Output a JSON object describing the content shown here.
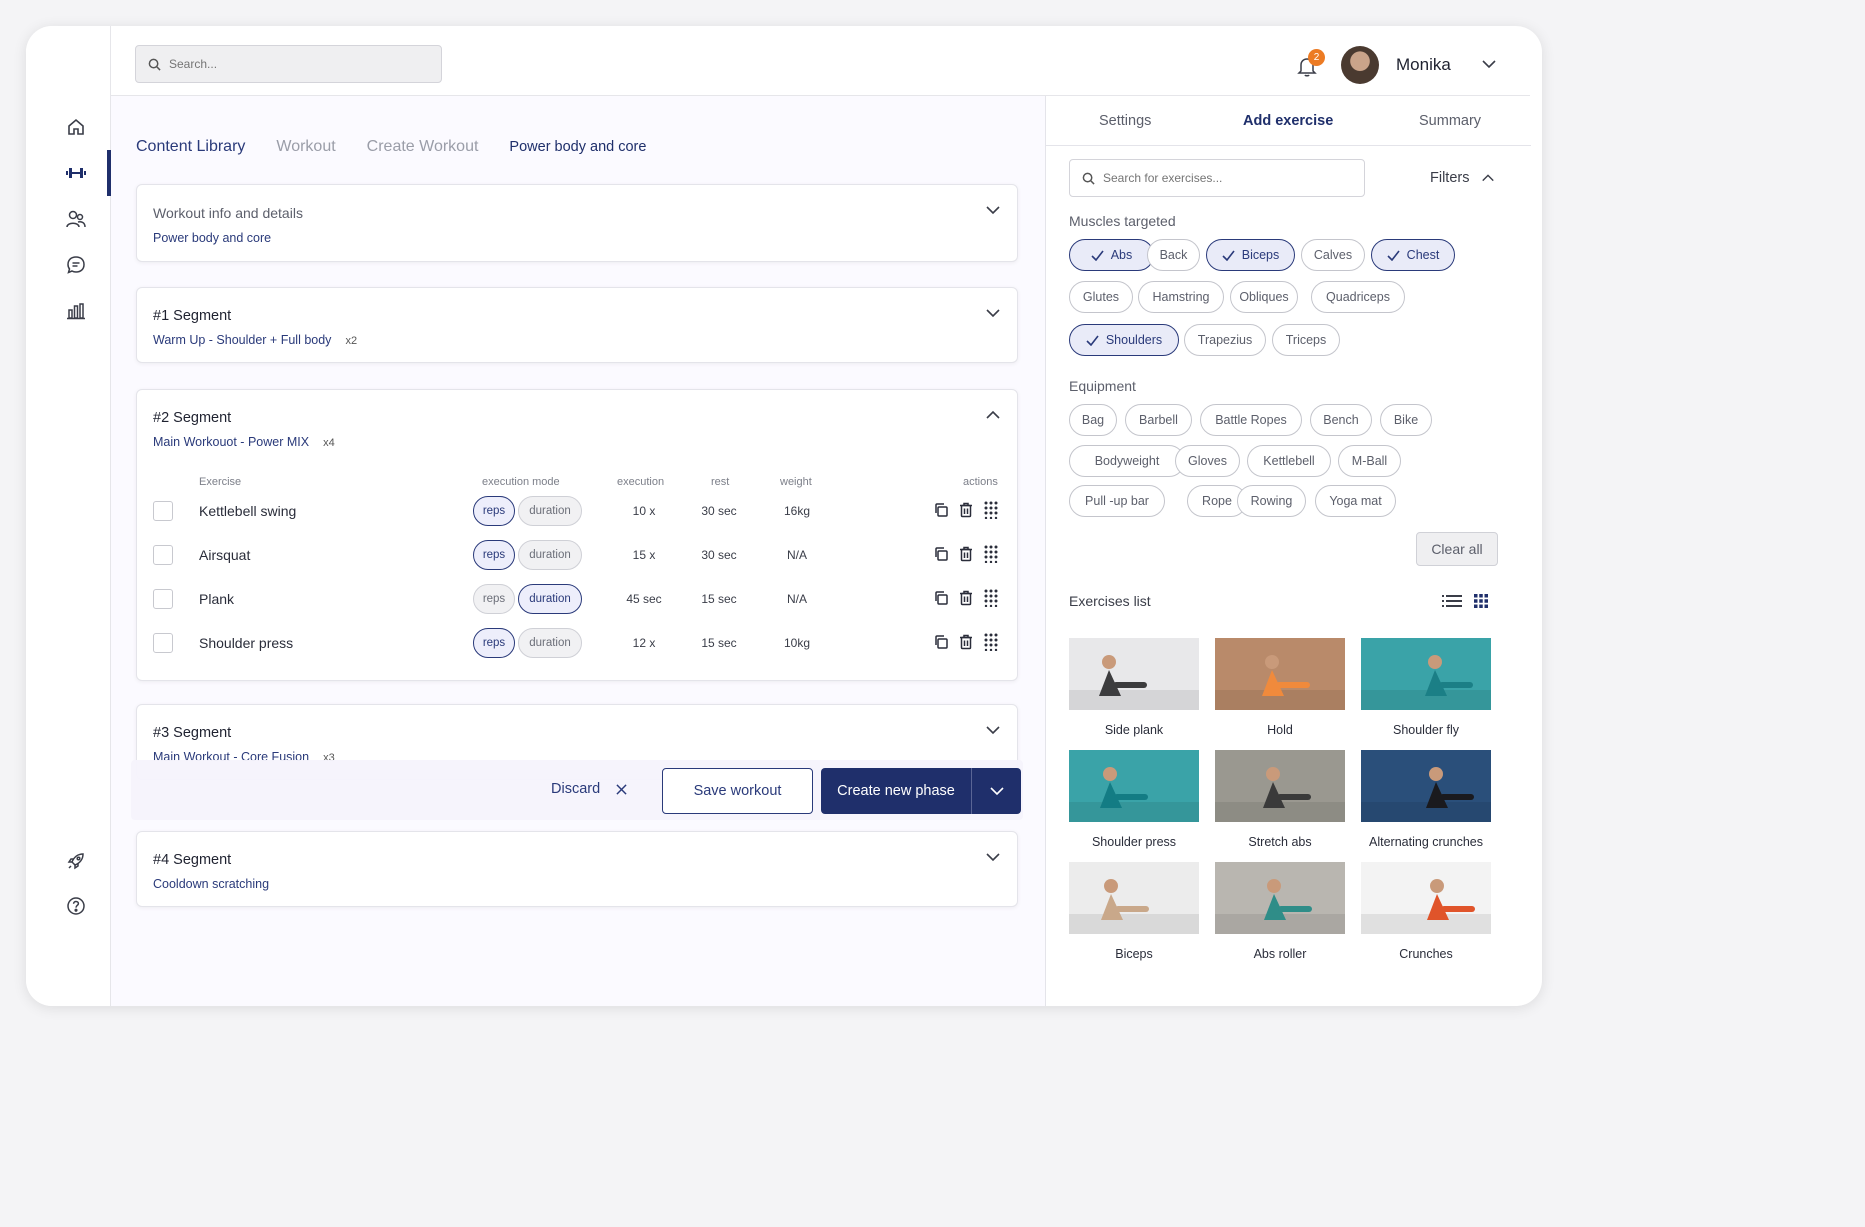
{
  "search": {
    "placeholder": "Search..."
  },
  "user": {
    "name": "Monika",
    "notifications": "2"
  },
  "breadcrumb": [
    "Content Library",
    "Workout",
    "Create Workout",
    "Power body and core"
  ],
  "info_card": {
    "title": "Workout info and details",
    "subtitle": "Power body and core"
  },
  "segments": [
    {
      "title": "#1 Segment",
      "subtitle": "Warm Up - Shoulder + Full body",
      "multiplier": "x2"
    },
    {
      "title": "#2 Segment",
      "subtitle": "Main Workouot - Power MIX",
      "multiplier": "x4"
    },
    {
      "title": "#3 Segment",
      "subtitle": "Main Workout - Core Fusion",
      "multiplier": "x3"
    },
    {
      "title": "#4 Segment",
      "subtitle": "Cooldown scratching"
    }
  ],
  "table": {
    "headers": {
      "exercise": "Exercise",
      "mode": "execution mode",
      "execution": "execution",
      "rest": "rest",
      "weight": "weight",
      "actions": "actions"
    },
    "mode_labels": {
      "reps": "reps",
      "duration": "duration"
    },
    "rows": [
      {
        "name": "Kettlebell swing",
        "mode": "reps",
        "execution": "10 x",
        "rest": "30 sec",
        "weight": "16kg"
      },
      {
        "name": "Airsquat",
        "mode": "reps",
        "execution": "15 x",
        "rest": "30 sec",
        "weight": "N/A"
      },
      {
        "name": "Plank",
        "mode": "duration",
        "execution": "45 sec",
        "rest": "15 sec",
        "weight": "N/A"
      },
      {
        "name": "Shoulder press",
        "mode": "reps",
        "execution": "12 x",
        "rest": "15 sec",
        "weight": "10kg"
      }
    ]
  },
  "action_bar": {
    "discard": "Discard",
    "save": "Save workout",
    "create": "Create new phase"
  },
  "panel": {
    "tabs": [
      "Settings",
      "Add exercise",
      "Summary"
    ],
    "active_tab": "Add exercise",
    "search_placeholder": "Search for exercises...",
    "filters_label": "Filters",
    "muscles_label": "Muscles targeted",
    "muscles": [
      {
        "label": "Abs",
        "selected": true
      },
      {
        "label": "Back",
        "selected": false
      },
      {
        "label": "Biceps",
        "selected": true
      },
      {
        "label": "Calves",
        "selected": false
      },
      {
        "label": "Chest",
        "selected": true
      },
      {
        "label": "Glutes",
        "selected": false
      },
      {
        "label": "Hamstring",
        "selected": false
      },
      {
        "label": "Obliques",
        "selected": false
      },
      {
        "label": "Quadriceps",
        "selected": false
      },
      {
        "label": "Shoulders",
        "selected": true
      },
      {
        "label": "Trapezius",
        "selected": false
      },
      {
        "label": "Triceps",
        "selected": false
      }
    ],
    "equipment_label": "Equipment",
    "equipment": [
      "Bag",
      "Barbell",
      "Battle Ropes",
      "Bench",
      "Bike",
      "Bodyweight",
      "Gloves",
      "Kettlebell",
      "M-Ball",
      "Pull -up bar",
      "Rope",
      "Rowing",
      "Yoga mat"
    ],
    "clear_all": "Clear all",
    "list_label": "Exercises list",
    "exercises": [
      {
        "name": "Side plank",
        "bg": "#e8e8ea",
        "fig": "#3c3c3e"
      },
      {
        "name": "Hold",
        "bg": "#b98a6a",
        "fig": "#f08a3c"
      },
      {
        "name": "Shoulder fly",
        "bg": "#3aa3a8",
        "fig": "#1b7f86"
      },
      {
        "name": "Shoulder press",
        "bg": "#3aa3a8",
        "fig": "#137c84"
      },
      {
        "name": "Stretch abs",
        "bg": "#9a9890",
        "fig": "#3a3a3a"
      },
      {
        "name": "Alternating crunches",
        "bg": "#2a4f7a",
        "fig": "#1a1a1e"
      },
      {
        "name": "Biceps",
        "bg": "#ececec",
        "fig": "#c9a88a"
      },
      {
        "name": "Abs roller",
        "bg": "#b9b6b0",
        "fig": "#2f8d88"
      },
      {
        "name": "Crunches",
        "bg": "#f3f3f3",
        "fig": "#e0542a"
      }
    ]
  },
  "colors": {
    "primary": "#1f2f6b",
    "accent": "#ec7b24",
    "chip_selected_bg": "#e9ebf8"
  }
}
